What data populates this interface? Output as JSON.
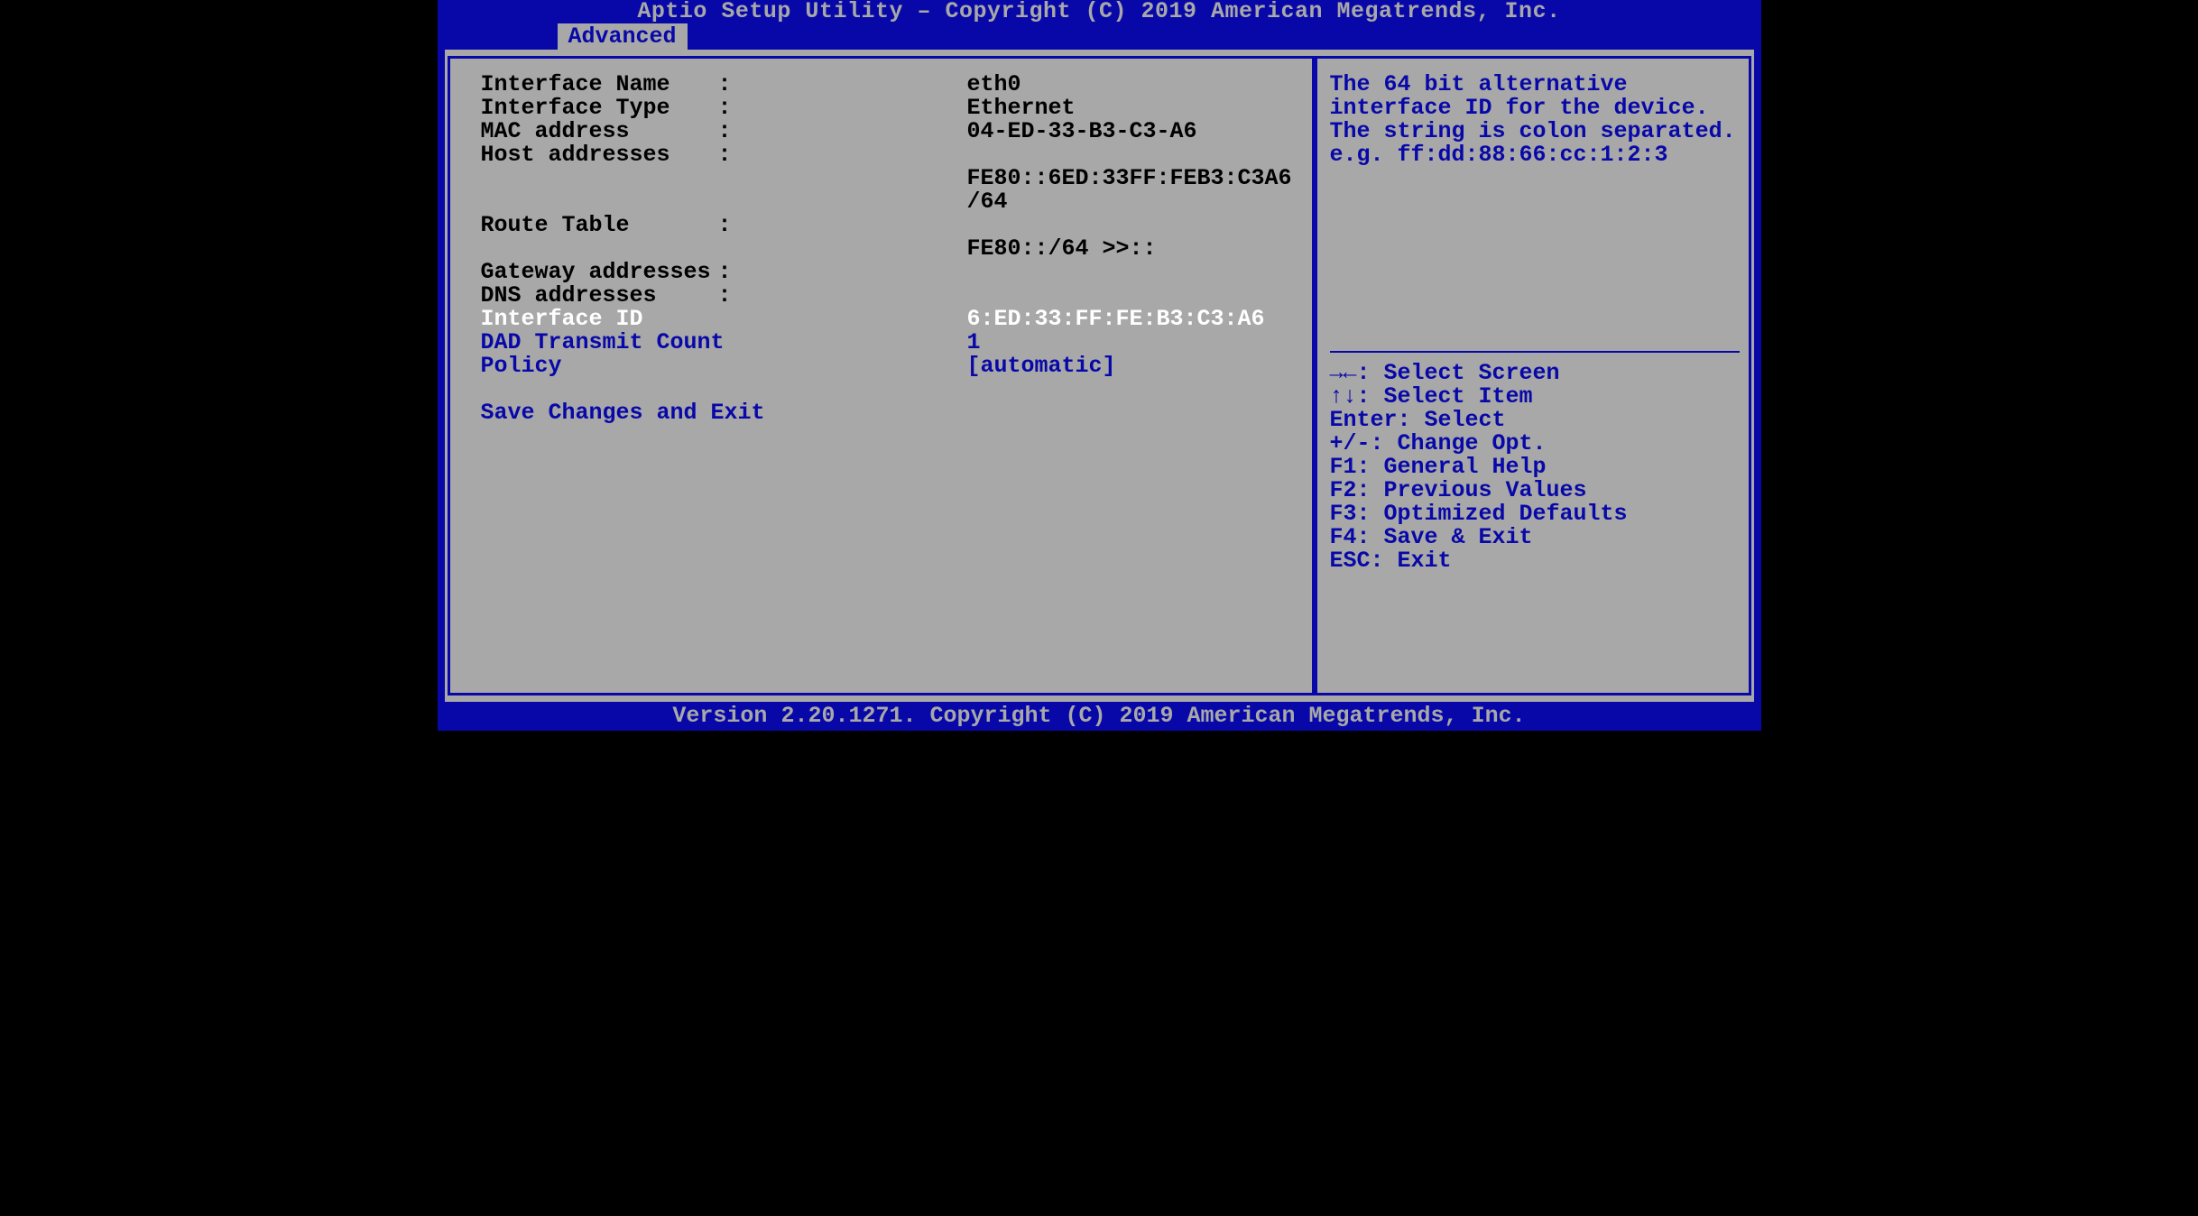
{
  "header": {
    "title": "Aptio Setup Utility – Copyright (C) 2019 American Megatrends, Inc."
  },
  "tabs": {
    "active": "Advanced"
  },
  "left": {
    "rows": {
      "interface_name": {
        "label": "Interface Name",
        "value": "eth0"
      },
      "interface_type": {
        "label": "Interface Type",
        "value": "Ethernet"
      },
      "mac_address": {
        "label": "MAC address",
        "value": "04-ED-33-B3-C3-A6"
      },
      "host_addresses": {
        "label": "Host addresses",
        "value": ""
      },
      "host_addr_l1": "FE80::6ED:33FF:FEB3:C3A6",
      "host_addr_l2": "/64",
      "route_table": {
        "label": "Route Table",
        "value": ""
      },
      "route_l1": "FE80::/64 >>::",
      "gateway_addresses": {
        "label": "Gateway addresses",
        "value": ""
      },
      "dns_addresses": {
        "label": "DNS addresses",
        "value": ""
      },
      "interface_id": {
        "label": "Interface ID",
        "value": "6:ED:33:FF:FE:B3:C3:A6"
      },
      "dad_transmit": {
        "label": "DAD Transmit Count",
        "value": "1"
      },
      "policy": {
        "label": "Policy",
        "value": "[automatic]"
      },
      "save_exit": {
        "label": "Save Changes and Exit"
      }
    }
  },
  "help": {
    "text": "The 64 bit alternative interface ID for the device. The string is colon separated. e.g. ff:dd:88:66:cc:1:2:3"
  },
  "keys": {
    "select_screen": "→←: Select Screen",
    "select_item": "↑↓: Select Item",
    "enter_select": "Enter: Select",
    "change_opt": "+/-: Change Opt.",
    "general_help": "F1: General Help",
    "previous_values": "F2: Previous Values",
    "opt_defaults": "F3: Optimized Defaults",
    "save_exit": "F4: Save & Exit",
    "esc_exit": "ESC: Exit"
  },
  "footer": {
    "text": "Version 2.20.1271. Copyright (C) 2019 American Megatrends, Inc."
  }
}
